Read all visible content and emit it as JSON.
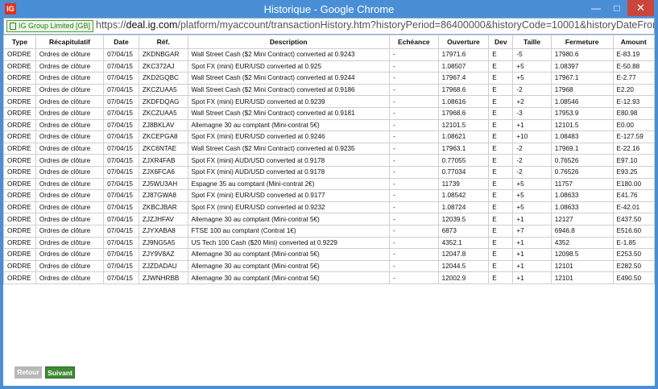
{
  "window": {
    "title": "Historique - Google Chrome",
    "app_icon": "IG"
  },
  "address": {
    "secure_label": "IG Group Limited [GB]",
    "url_scheme": "https://",
    "url_host": "deal.ig.com",
    "url_path": "/platform/myaccount/transactionHistory.htm?historyPeriod=86400000&historyCode=10001&historyDateFrom=TODAY&"
  },
  "table": {
    "headers": [
      "Type",
      "Récapitulatif",
      "Date",
      "Réf.",
      "Description",
      "Echéance",
      "Ouverture",
      "Dev",
      "Taille",
      "Fermeture",
      "Amount"
    ],
    "rows": [
      [
        "ORDRE",
        "Ordres de clôture",
        "07/04/15",
        "ZKDNBGAR",
        "Wall Street Cash ($2 Mini Contract) converted at 0.9243",
        "-",
        "17971.6",
        "E",
        "-5",
        "17980.6",
        "E-83.19"
      ],
      [
        "ORDRE",
        "Ordres de clôture",
        "07/04/15",
        "ZKC372AJ",
        "Spot FX (mini) EUR/USD converted at 0.925",
        "-",
        "1.08507",
        "E",
        "+5",
        "1.08397",
        "E-50.88"
      ],
      [
        "ORDRE",
        "Ordres de clôture",
        "07/04/15",
        "ZKD2GQBC",
        "Wall Street Cash ($2 Mini Contract) converted at 0.9244",
        "-",
        "17967.4",
        "E",
        "+5",
        "17967.1",
        "E-2.77"
      ],
      [
        "ORDRE",
        "Ordres de clôture",
        "07/04/15",
        "ZKCZUAA5",
        "Wall Street Cash ($2 Mini Contract) converted at 0.9186",
        "-",
        "17968.6",
        "E",
        "-2",
        "17968",
        "E2.20"
      ],
      [
        "ORDRE",
        "Ordres de clôture",
        "07/04/15",
        "ZKDFDQAG",
        "Spot FX (mini) EUR/USD converted at 0.9239",
        "-",
        "1.08616",
        "E",
        "+2",
        "1.08546",
        "E-12.93"
      ],
      [
        "ORDRE",
        "Ordres de clôture",
        "07/04/15",
        "ZKCZUAA5",
        "Wall Street Cash ($2 Mini Contract) converted at 0.9181",
        "-",
        "17968.6",
        "E",
        "-3",
        "17953.9",
        "E80.98"
      ],
      [
        "ORDRE",
        "Ordres de clôture",
        "07/04/15",
        "ZJ8BKLAV",
        "Allemagne 30 au comptant (Mini-contrat 5€)",
        "-",
        "12101.5",
        "E",
        "+1",
        "12101.5",
        "E0.00"
      ],
      [
        "ORDRE",
        "Ordres de clôture",
        "07/04/15",
        "ZKCEPGA8",
        "Spot FX (mini) EUR/USD converted at 0.9246",
        "-",
        "1.08621",
        "E",
        "+10",
        "1.08483",
        "E-127.59"
      ],
      [
        "ORDRE",
        "Ordres de clôture",
        "07/04/15",
        "ZKC6NTAE",
        "Wall Street Cash ($2 Mini Contract) converted at 0.9235",
        "-",
        "17963.1",
        "E",
        "-2",
        "17969.1",
        "E-22.16"
      ],
      [
        "ORDRE",
        "Ordres de clôture",
        "07/04/15",
        "ZJXR4FAB",
        "Spot FX (mini) AUD/USD converted at 0.9178",
        "-",
        "0.77055",
        "E",
        "-2",
        "0.76526",
        "E97.10"
      ],
      [
        "ORDRE",
        "Ordres de clôture",
        "07/04/15",
        "ZJX6FCA6",
        "Spot FX (mini) AUD/USD converted at 0.9178",
        "-",
        "0.77034",
        "E",
        "-2",
        "0.76526",
        "E93.25"
      ],
      [
        "ORDRE",
        "Ordres de clôture",
        "07/04/15",
        "ZJ5WU3AH",
        "Espagne 35 au comptant (Mini-contrat 2€)",
        "-",
        "11739",
        "E",
        "+5",
        "11757",
        "E180.00"
      ],
      [
        "ORDRE",
        "Ordres de clôture",
        "07/04/15",
        "ZJ87GWA8",
        "Spot FX (mini) EUR/USD converted at 0.9177",
        "-",
        "1.08542",
        "E",
        "+5",
        "1.08633",
        "E41.76"
      ],
      [
        "ORDRE",
        "Ordres de clôture",
        "07/04/15",
        "ZKBCJBAR",
        "Spot FX (mini) EUR/USD converted at 0.9232",
        "-",
        "1.08724",
        "E",
        "+5",
        "1.08633",
        "E-42.01"
      ],
      [
        "ORDRE",
        "Ordres de clôture",
        "07/04/15",
        "ZJZJHFAV",
        "Allemagne 30 au comptant (Mini-contrat 5€)",
        "-",
        "12039.5",
        "E",
        "+1",
        "12127",
        "E437.50"
      ],
      [
        "ORDRE",
        "Ordres de clôture",
        "07/04/15",
        "ZJYXABA8",
        "FTSE 100 au comptant (Contrat 1€)",
        "-",
        "6873",
        "E",
        "+7",
        "6946.8",
        "E516.60"
      ],
      [
        "ORDRE",
        "Ordres de clôture",
        "07/04/15",
        "ZJ9NG5A5",
        "US Tech 100 Cash ($20 Mini) converted at 0.9229",
        "-",
        "4352.1",
        "E",
        "+1",
        "4352",
        "E-1.85"
      ],
      [
        "ORDRE",
        "Ordres de clôture",
        "07/04/15",
        "ZJY9V8AZ",
        "Allemagne 30 au comptant (Mini-contrat 5€)",
        "-",
        "12047.8",
        "E",
        "+1",
        "12098.5",
        "E253.50"
      ],
      [
        "ORDRE",
        "Ordres de clôture",
        "07/04/15",
        "ZJZDADAU",
        "Allemagne 30 au comptant (Mini-contrat 5€)",
        "-",
        "12044.5",
        "E",
        "+1",
        "12101",
        "E282.50"
      ],
      [
        "ORDRE",
        "Ordres de clôture",
        "07/04/15",
        "ZJWNHRBB",
        "Allemagne 30 au comptant (Mini-contrat 5€)",
        "-",
        "12002.9",
        "E",
        "+1",
        "12101",
        "E490.50"
      ]
    ]
  },
  "pagination": {
    "prev_label": "Retour",
    "next_label": "Suivant"
  },
  "colors": {
    "window_frame": "#4a8fd6",
    "close_button": "#c9463d",
    "next_button": "#3f8a35",
    "prev_button": "#b8b8b8"
  }
}
